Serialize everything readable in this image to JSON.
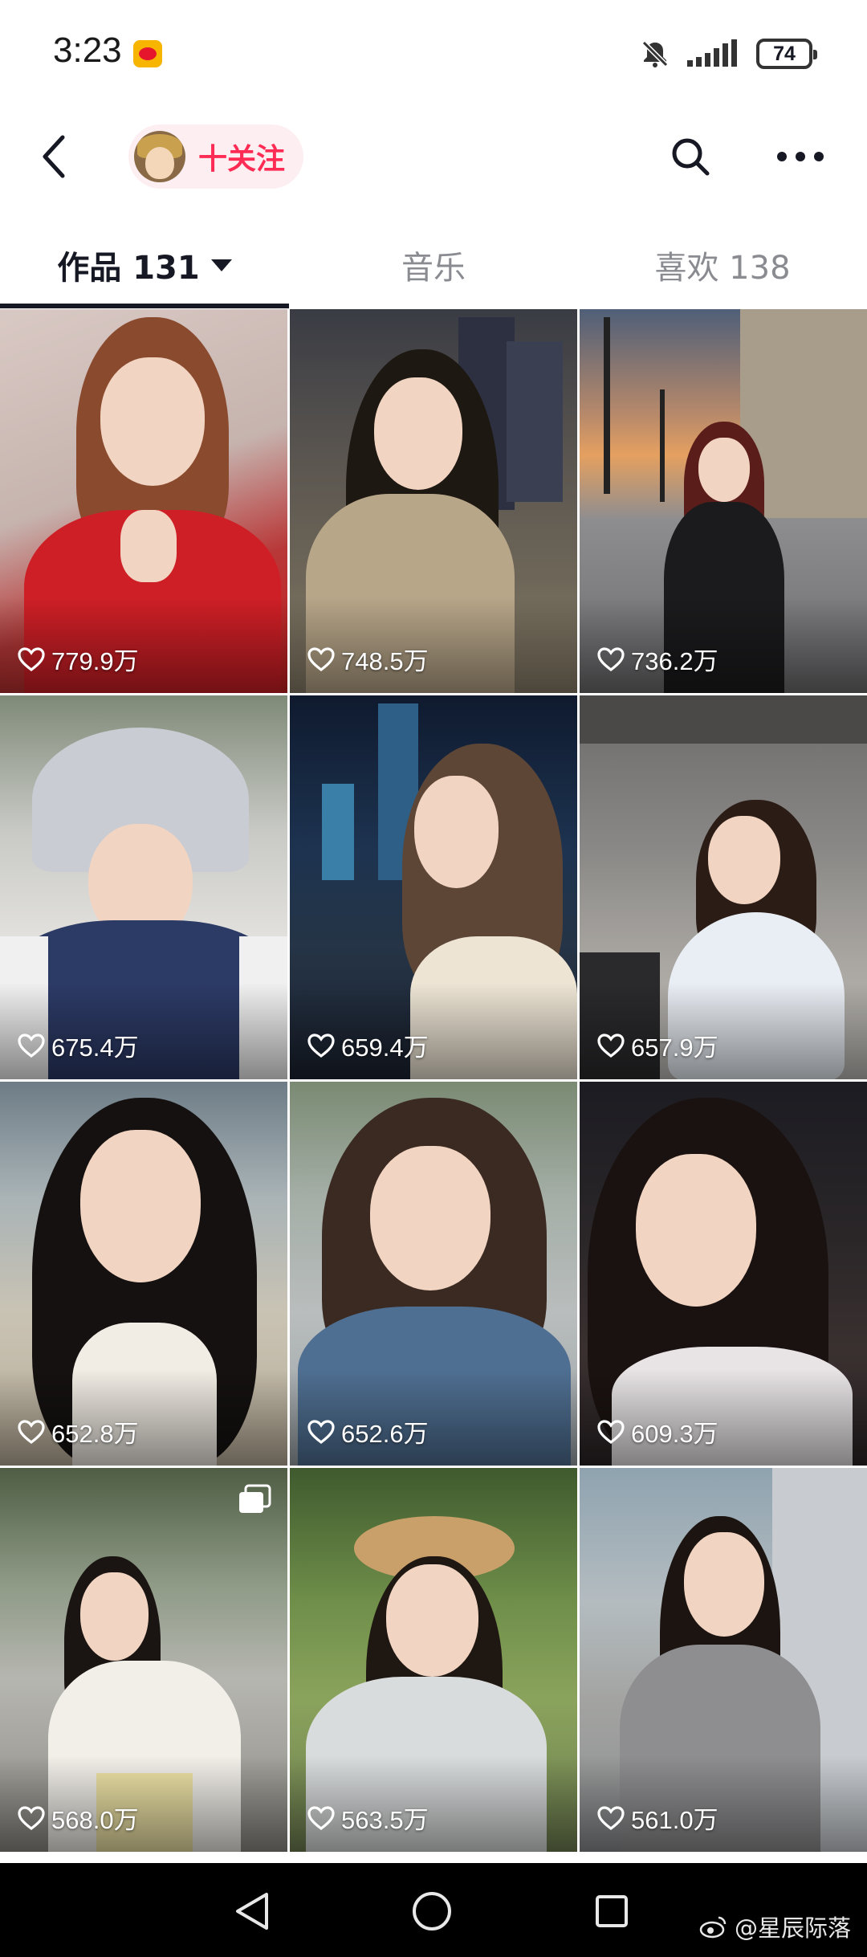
{
  "status_bar": {
    "time": "3:23",
    "battery": "74",
    "icons": [
      "weibo-notification-icon",
      "mute-icon",
      "signal-icon",
      "battery-icon"
    ]
  },
  "top_nav": {
    "follow_label": "十关注",
    "icons": [
      "back-arrow-icon",
      "search-icon",
      "more-icon"
    ]
  },
  "tabs": [
    {
      "label": "作品 131",
      "active": true
    },
    {
      "label": "音乐",
      "active": false
    },
    {
      "label": "喜欢 138",
      "active": false
    }
  ],
  "accent_color": "#fe2c55",
  "videos": [
    {
      "likes": "779.9万"
    },
    {
      "likes": "748.5万"
    },
    {
      "likes": "736.2万"
    },
    {
      "likes": "675.4万"
    },
    {
      "likes": "659.4万"
    },
    {
      "likes": "657.9万"
    },
    {
      "likes": "652.8万"
    },
    {
      "likes": "652.6万"
    },
    {
      "likes": "609.3万"
    },
    {
      "likes": "568.0万",
      "multi_image": true
    },
    {
      "likes": "563.5万"
    },
    {
      "likes": "561.0万"
    }
  ],
  "system_nav": {
    "icons": [
      "nav-back-icon",
      "nav-home-icon",
      "nav-recents-icon"
    ],
    "watermark": "@星辰际落"
  }
}
